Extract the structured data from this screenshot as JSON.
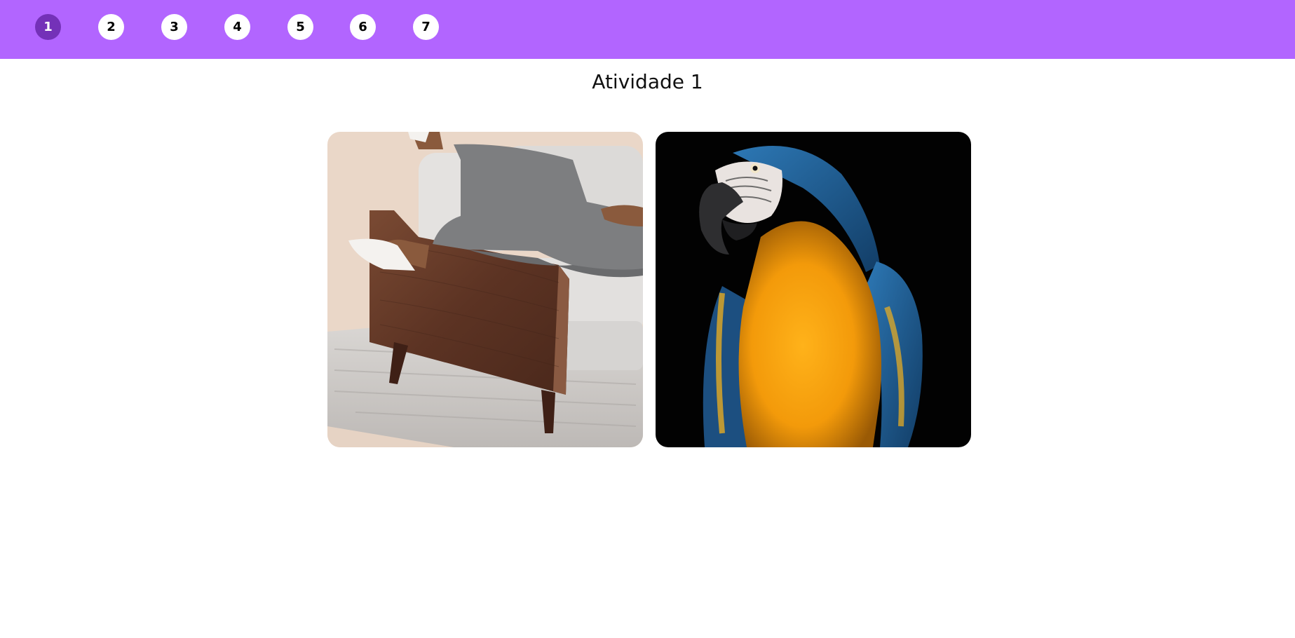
{
  "steps": [
    {
      "label": "1",
      "active": true
    },
    {
      "label": "2",
      "active": false
    },
    {
      "label": "3",
      "active": false
    },
    {
      "label": "4",
      "active": false
    },
    {
      "label": "5",
      "active": false
    },
    {
      "label": "6",
      "active": false
    },
    {
      "label": "7",
      "active": false
    }
  ],
  "title": "Atividade 1",
  "colors": {
    "topbar": "#b265ff",
    "active_step": "#7431b8",
    "inactive_step": "#ffffff"
  },
  "images": [
    {
      "subject": "person-on-armchair"
    },
    {
      "subject": "macaw-parrot"
    }
  ]
}
